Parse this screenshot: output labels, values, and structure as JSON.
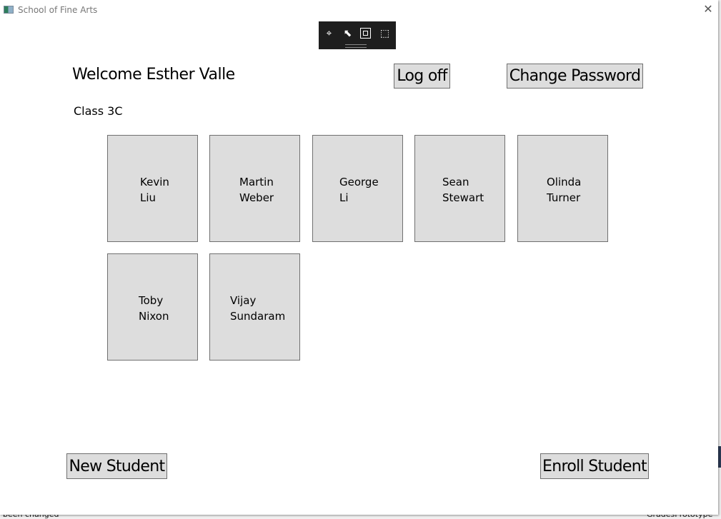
{
  "window": {
    "title": "School of Fine Arts",
    "close_icon": "close-icon"
  },
  "background": {
    "left_text": "been changed",
    "right_text": "GradesPrototype"
  },
  "devtools": {
    "icons": [
      "select-element-icon",
      "pointer-icon",
      "layout-adorner-icon",
      "track-focus-icon"
    ]
  },
  "header": {
    "welcome": "Welcome Esther Valle",
    "log_off": "Log off",
    "change_password": "Change Password"
  },
  "class_label": "Class 3C",
  "students": [
    {
      "first": "Kevin",
      "last": "Liu"
    },
    {
      "first": "Martin",
      "last": "Weber"
    },
    {
      "first": "George",
      "last": "Li"
    },
    {
      "first": "Sean",
      "last": "Stewart"
    },
    {
      "first": "Olinda",
      "last": "Turner"
    },
    {
      "first": "Toby",
      "last": "Nixon"
    },
    {
      "first": "Vijay",
      "last": "Sundaram"
    }
  ],
  "footer": {
    "new_student": "New Student",
    "enroll_student": "Enroll Student"
  }
}
